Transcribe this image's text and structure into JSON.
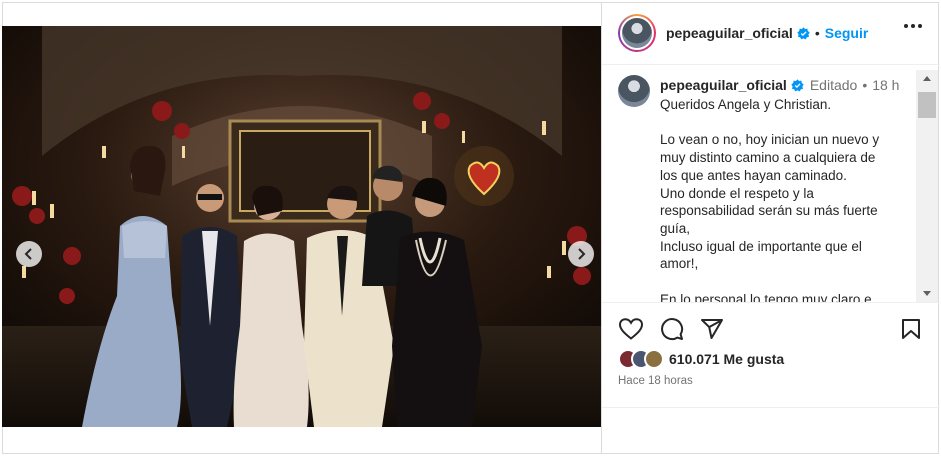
{
  "post": {
    "username": "pepeaguilar_oficial",
    "follow_label": "Seguir",
    "separator": "•",
    "edited_label": "Editado",
    "time_label": "18 h",
    "caption_lines": [
      "Queridos Angela y Christian.",
      "",
      "Lo vean o no, hoy inician un nuevo y",
      "muy distinto camino a cualquiera de",
      "los que antes hayan caminado.",
      "Uno donde el respeto y la",
      "responsabilidad serán su más fuerte",
      "guía,",
      "Incluso igual de importante que el",
      "amor!,",
      "",
      "En lo personal lo tengo muy claro e"
    ],
    "likes": "610.071 Me gusta",
    "posted_ago": "Hace 18 horas"
  },
  "carousel": {
    "slides": 4,
    "active_index": 2
  },
  "icons": {
    "verified": "verified-badge-icon",
    "more": "more-options-icon",
    "like": "heart-icon",
    "comment": "comment-icon",
    "share": "share-icon",
    "save": "bookmark-icon",
    "prev": "chevron-left-icon",
    "next": "chevron-right-icon"
  },
  "colors": {
    "accent": "#0095f6",
    "verified": "#0095f6",
    "text": "#262626",
    "muted": "#737373",
    "border": "#dbdbdb"
  }
}
